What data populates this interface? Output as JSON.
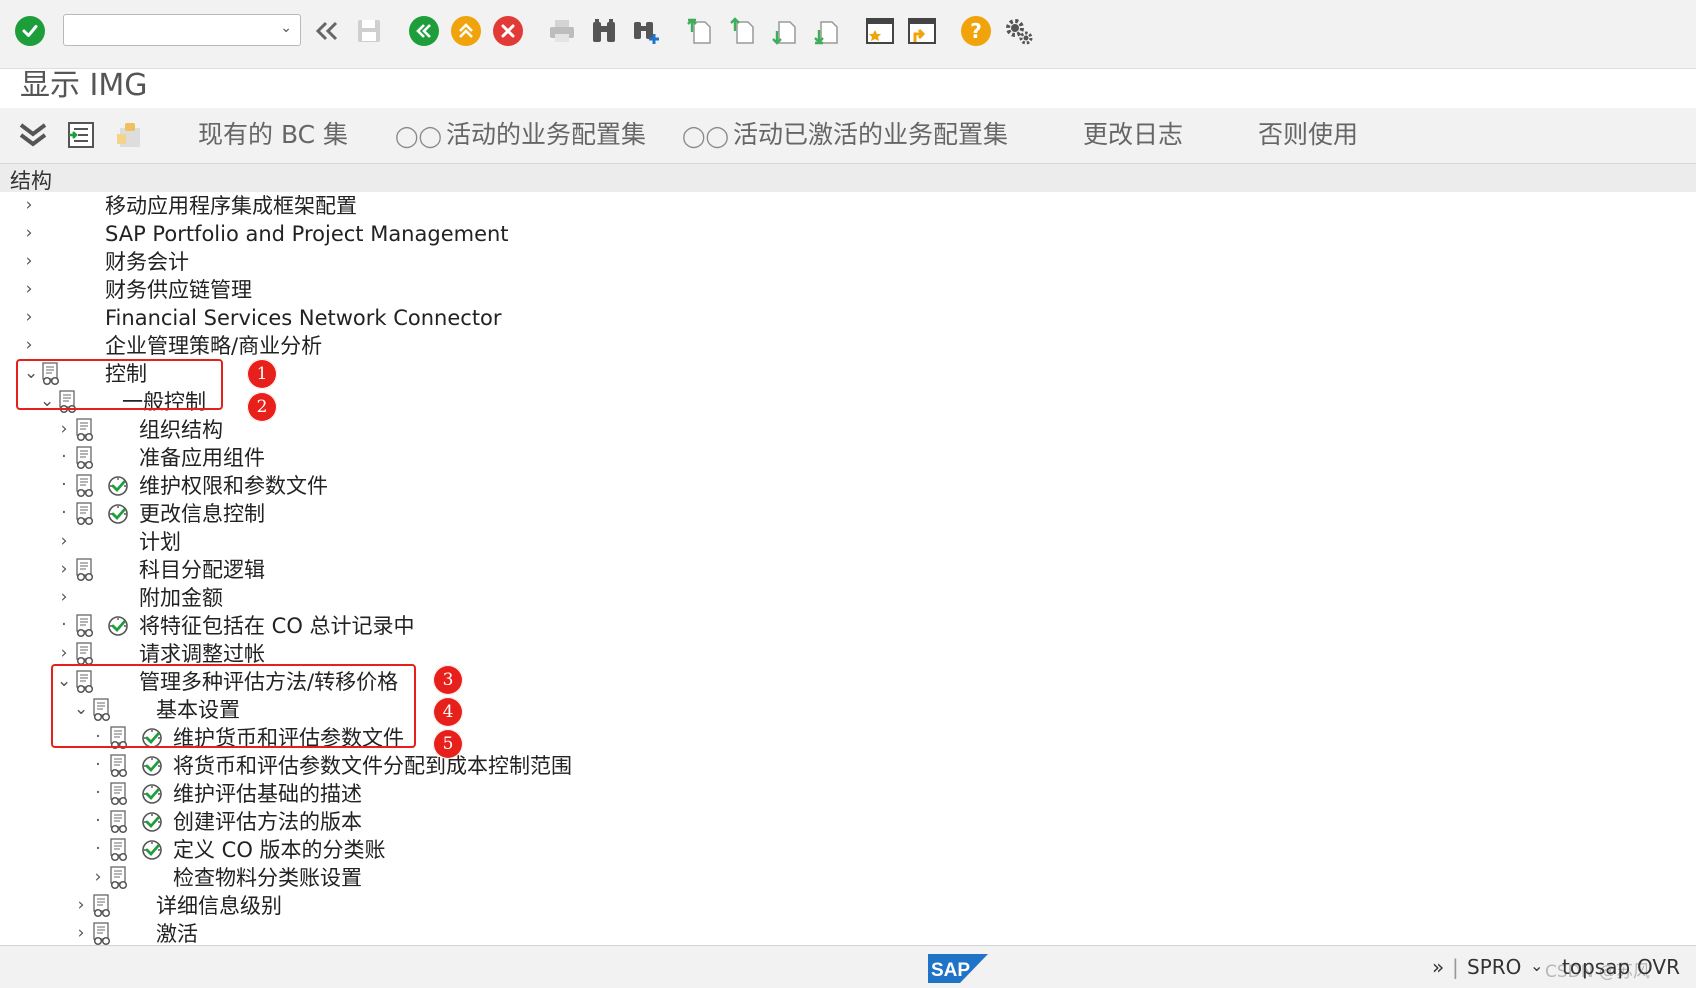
{
  "toolbar": {
    "command_field_value": "",
    "icons": [
      "enter-icon",
      "back-double-icon",
      "save-icon",
      "back-icon",
      "exit-icon",
      "cancel-icon",
      "print-icon",
      "find-icon",
      "find-next-icon",
      "first-page-icon",
      "previous-page-icon",
      "next-page-icon",
      "last-page-icon",
      "create-session-icon",
      "shortcut-icon",
      "help-icon",
      "settings-icon"
    ]
  },
  "title": "显示 IMG",
  "app_toolbar": {
    "existing_bc_sets": "现有的 BC 集",
    "active_bc_sets": "活动的业务配置集",
    "activated_bc_sets": "活动已激活的业务配置集",
    "change_log": "更改日志",
    "where_used": "否则使用"
  },
  "tree": {
    "header": "结构",
    "items": [
      {
        "label": "移动应用程序集成框架配置",
        "expander": "collapsed"
      },
      {
        "label": "SAP Portfolio and Project Management",
        "expander": "collapsed"
      },
      {
        "label": "财务会计",
        "expander": "collapsed"
      },
      {
        "label": "财务供应链管理",
        "expander": "collapsed"
      },
      {
        "label": "Financial Services Network Connector",
        "expander": "collapsed"
      },
      {
        "label": "企业管理策略/商业分析",
        "expander": "collapsed"
      },
      {
        "label": "控制",
        "expander": "expanded"
      },
      {
        "label": "一般控制",
        "expander": "expanded"
      },
      {
        "label": "组织结构",
        "expander": "collapsed"
      },
      {
        "label": "准备应用组件",
        "expander": "leaf"
      },
      {
        "label": "维护权限和参数文件",
        "expander": "leaf"
      },
      {
        "label": "更改信息控制",
        "expander": "leaf"
      },
      {
        "label": "计划",
        "expander": "collapsed"
      },
      {
        "label": "科目分配逻辑",
        "expander": "collapsed"
      },
      {
        "label": "附加金额",
        "expander": "collapsed"
      },
      {
        "label": "将特征包括在 CO 总计记录中",
        "expander": "leaf"
      },
      {
        "label": "请求调整过帐",
        "expander": "collapsed"
      },
      {
        "label": "管理多种评估方法/转移价格",
        "expander": "expanded"
      },
      {
        "label": "基本设置",
        "expander": "expanded"
      },
      {
        "label": "维护货币和评估参数文件",
        "expander": "leaf"
      },
      {
        "label": "将货币和评估参数文件分配到成本控制范围",
        "expander": "leaf"
      },
      {
        "label": "维护评估基础的描述",
        "expander": "leaf"
      },
      {
        "label": "创建评估方法的版本",
        "expander": "leaf"
      },
      {
        "label": "定义 CO 版本的分类账",
        "expander": "leaf"
      },
      {
        "label": "检查物料分类账设置",
        "expander": "collapsed"
      },
      {
        "label": "详细信息级别",
        "expander": "collapsed"
      },
      {
        "label": "激活",
        "expander": "collapsed"
      }
    ]
  },
  "annotations": [
    "1",
    "2",
    "3",
    "4",
    "5"
  ],
  "footer": {
    "logo_text": "SAP",
    "nav_glyph": "»",
    "transaction": "SPRO",
    "system": "topsap",
    "mode": "OVR",
    "watermark": "CSDN @苏风"
  },
  "colors": {
    "green": "#1e9e3a",
    "orange": "#f0a30a",
    "red": "#e23a37",
    "annotation_red": "#e8201c",
    "sap_blue": "#1f74c8"
  }
}
